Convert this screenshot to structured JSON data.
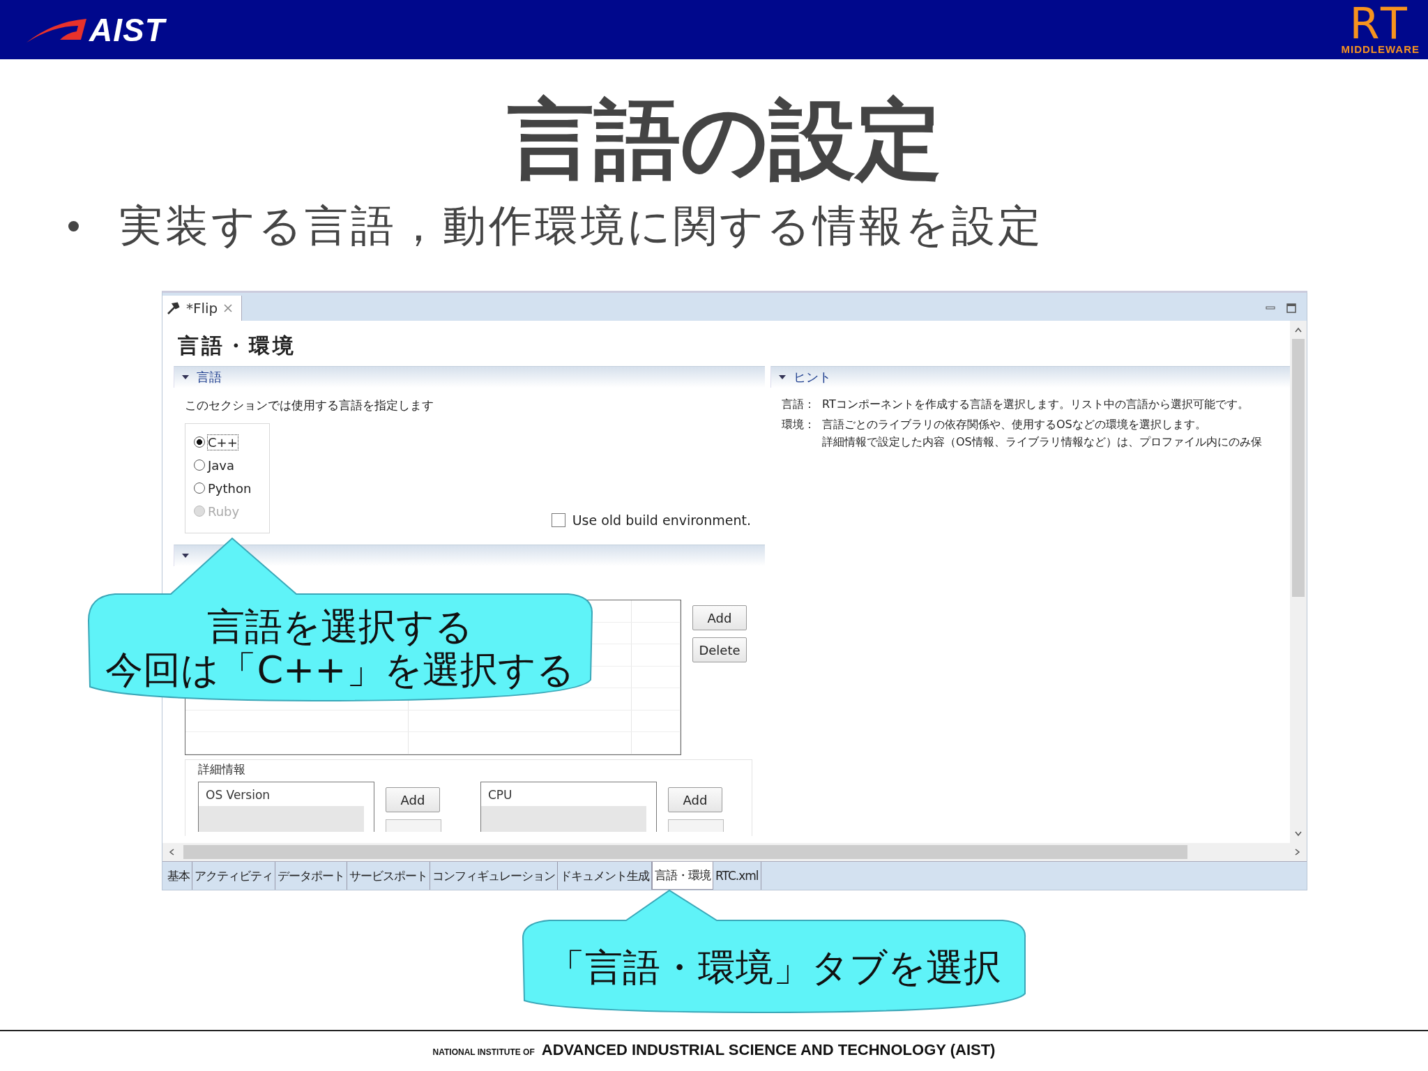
{
  "header": {
    "logo_text": "AIST",
    "rt_logo": {
      "letters": "RT",
      "caption": "MIDDLEWARE"
    }
  },
  "title": "言語の設定",
  "bullets": [
    "実装する言語，動作環境に関する情報を設定"
  ],
  "editor": {
    "tab_title": "*Flip",
    "form_title": "言語・環境",
    "language_section": {
      "title": "言語",
      "expanded": true,
      "description": "このセクションでは使用する言語を指定します",
      "options": [
        {
          "label": "C++",
          "selected": true,
          "disabled": false
        },
        {
          "label": "Java",
          "selected": false,
          "disabled": false
        },
        {
          "label": "Python",
          "selected": false,
          "disabled": false
        },
        {
          "label": "Ruby",
          "selected": false,
          "disabled": true
        }
      ],
      "old_build_env": {
        "label": "Use old build environment.",
        "checked": false
      }
    },
    "environment_section": {
      "expanded": true,
      "buttons": [
        "Add",
        "Delete"
      ]
    },
    "details": {
      "title": "詳細情報",
      "lists": [
        {
          "header": "OS Version",
          "button": "Add"
        },
        {
          "header": "CPU",
          "button": "Add"
        }
      ]
    },
    "hint_section": {
      "title": "ヒント",
      "expanded": true,
      "items": [
        {
          "term": "言語：",
          "lines": [
            "RTコンポーネントを作成する言語を選択します。リスト中の言語から選択可能です。"
          ]
        },
        {
          "term": "環境：",
          "lines": [
            "言語ごとのライブラリの依存関係や、使用するOSなどの環境を選択します。",
            "詳細情報で設定した内容（OS情報、ライブラリ情報など）は、プロファイル内にのみ保"
          ]
        }
      ]
    },
    "bottom_tabs": [
      {
        "label": "基本",
        "selected": false
      },
      {
        "label": "アクティビティ",
        "selected": false
      },
      {
        "label": "データポート",
        "selected": false
      },
      {
        "label": "サービスポート",
        "selected": false
      },
      {
        "label": "コンフィギュレーション",
        "selected": false
      },
      {
        "label": "ドキュメント生成",
        "selected": false
      },
      {
        "label": "言語・環境",
        "selected": true
      },
      {
        "label": "RTC.xml",
        "selected": false
      }
    ]
  },
  "callouts": [
    {
      "lines": [
        "言語を選択する",
        "今回は「C++」を選択する"
      ]
    },
    {
      "lines": [
        "「言語・環境」タブを選択"
      ]
    }
  ],
  "footer": {
    "prefix": "NATIONAL INSTITUTE OF",
    "name": "ADVANCED INDUSTRIAL SCIENCE AND TECHNOLOGY (AIST)"
  }
}
